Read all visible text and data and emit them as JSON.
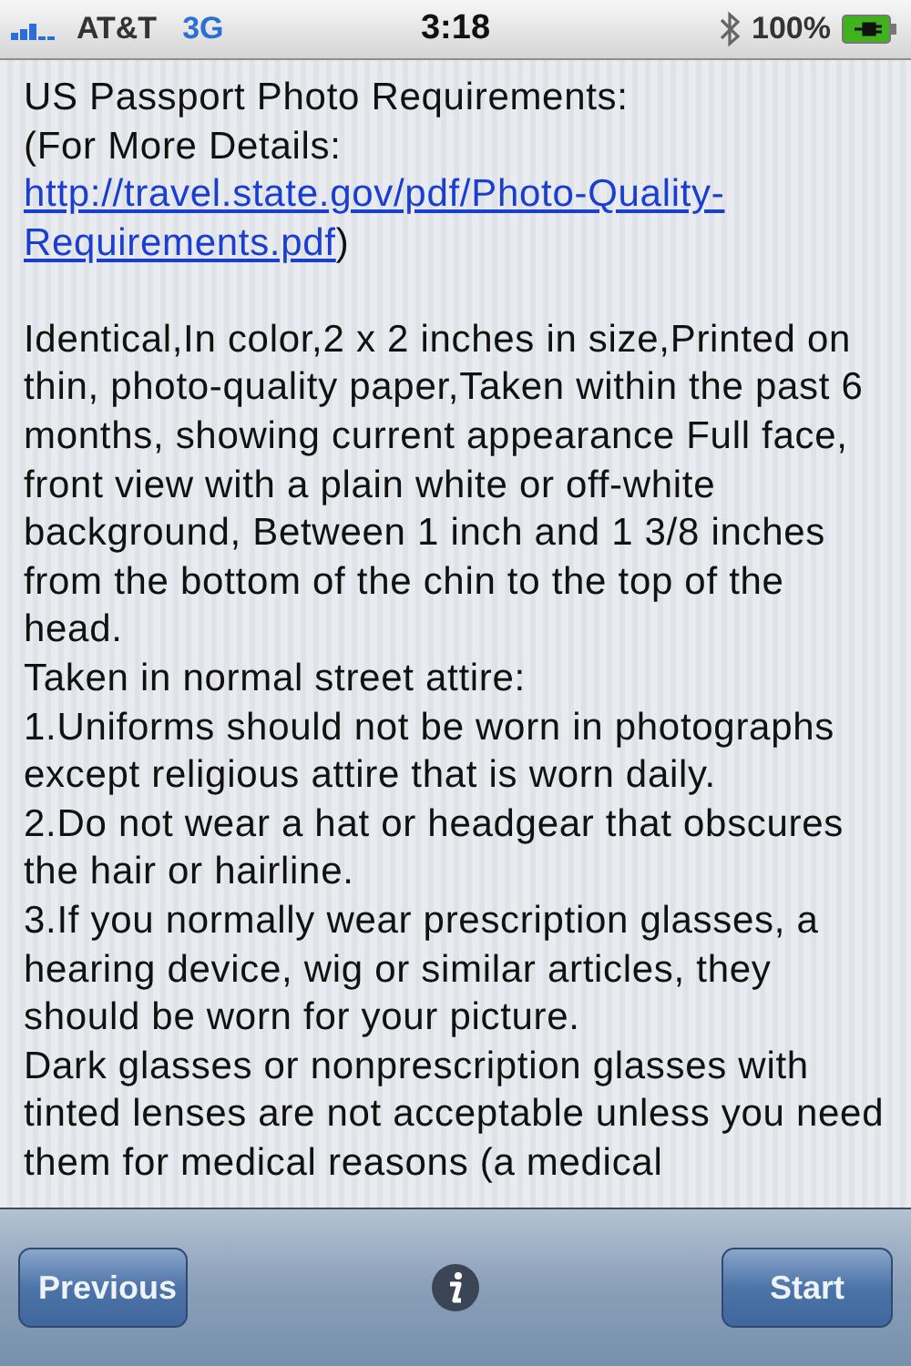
{
  "status_bar": {
    "carrier": "AT&T",
    "network": "3G",
    "time": "3:18",
    "battery": "100%"
  },
  "content": {
    "heading": "US Passport Photo Requirements:",
    "details_prefix": "(For More Details:",
    "details_link_lines": [
      "http://travel.state.gov/pdf/Photo-Quality-",
      "Requirements.pdf"
    ],
    "details_suffix": ")",
    "paragraphs": [
      "Identical,In color,2 x 2 inches in size,Printed on thin, photo-quality paper,Taken within the past 6 months, showing current appearance Full face, front view with a plain white or off-white background, Between 1 inch and 1 3/8 inches from the bottom of the chin to the top of the head.",
      "Taken in normal street attire:",
      "1.Uniforms should not be worn in photographs except religious attire that is worn daily.",
      "2.Do not wear a hat or headgear that obscures the hair or hairline.",
      "3.If you normally wear prescription glasses, a hearing device, wig or similar articles, they should be worn for your picture.",
      "Dark glasses or nonprescription glasses with tinted lenses are not acceptable unless you need them for medical reasons (a medical"
    ]
  },
  "toolbar": {
    "left_button": "Previous",
    "right_button": "Start"
  }
}
